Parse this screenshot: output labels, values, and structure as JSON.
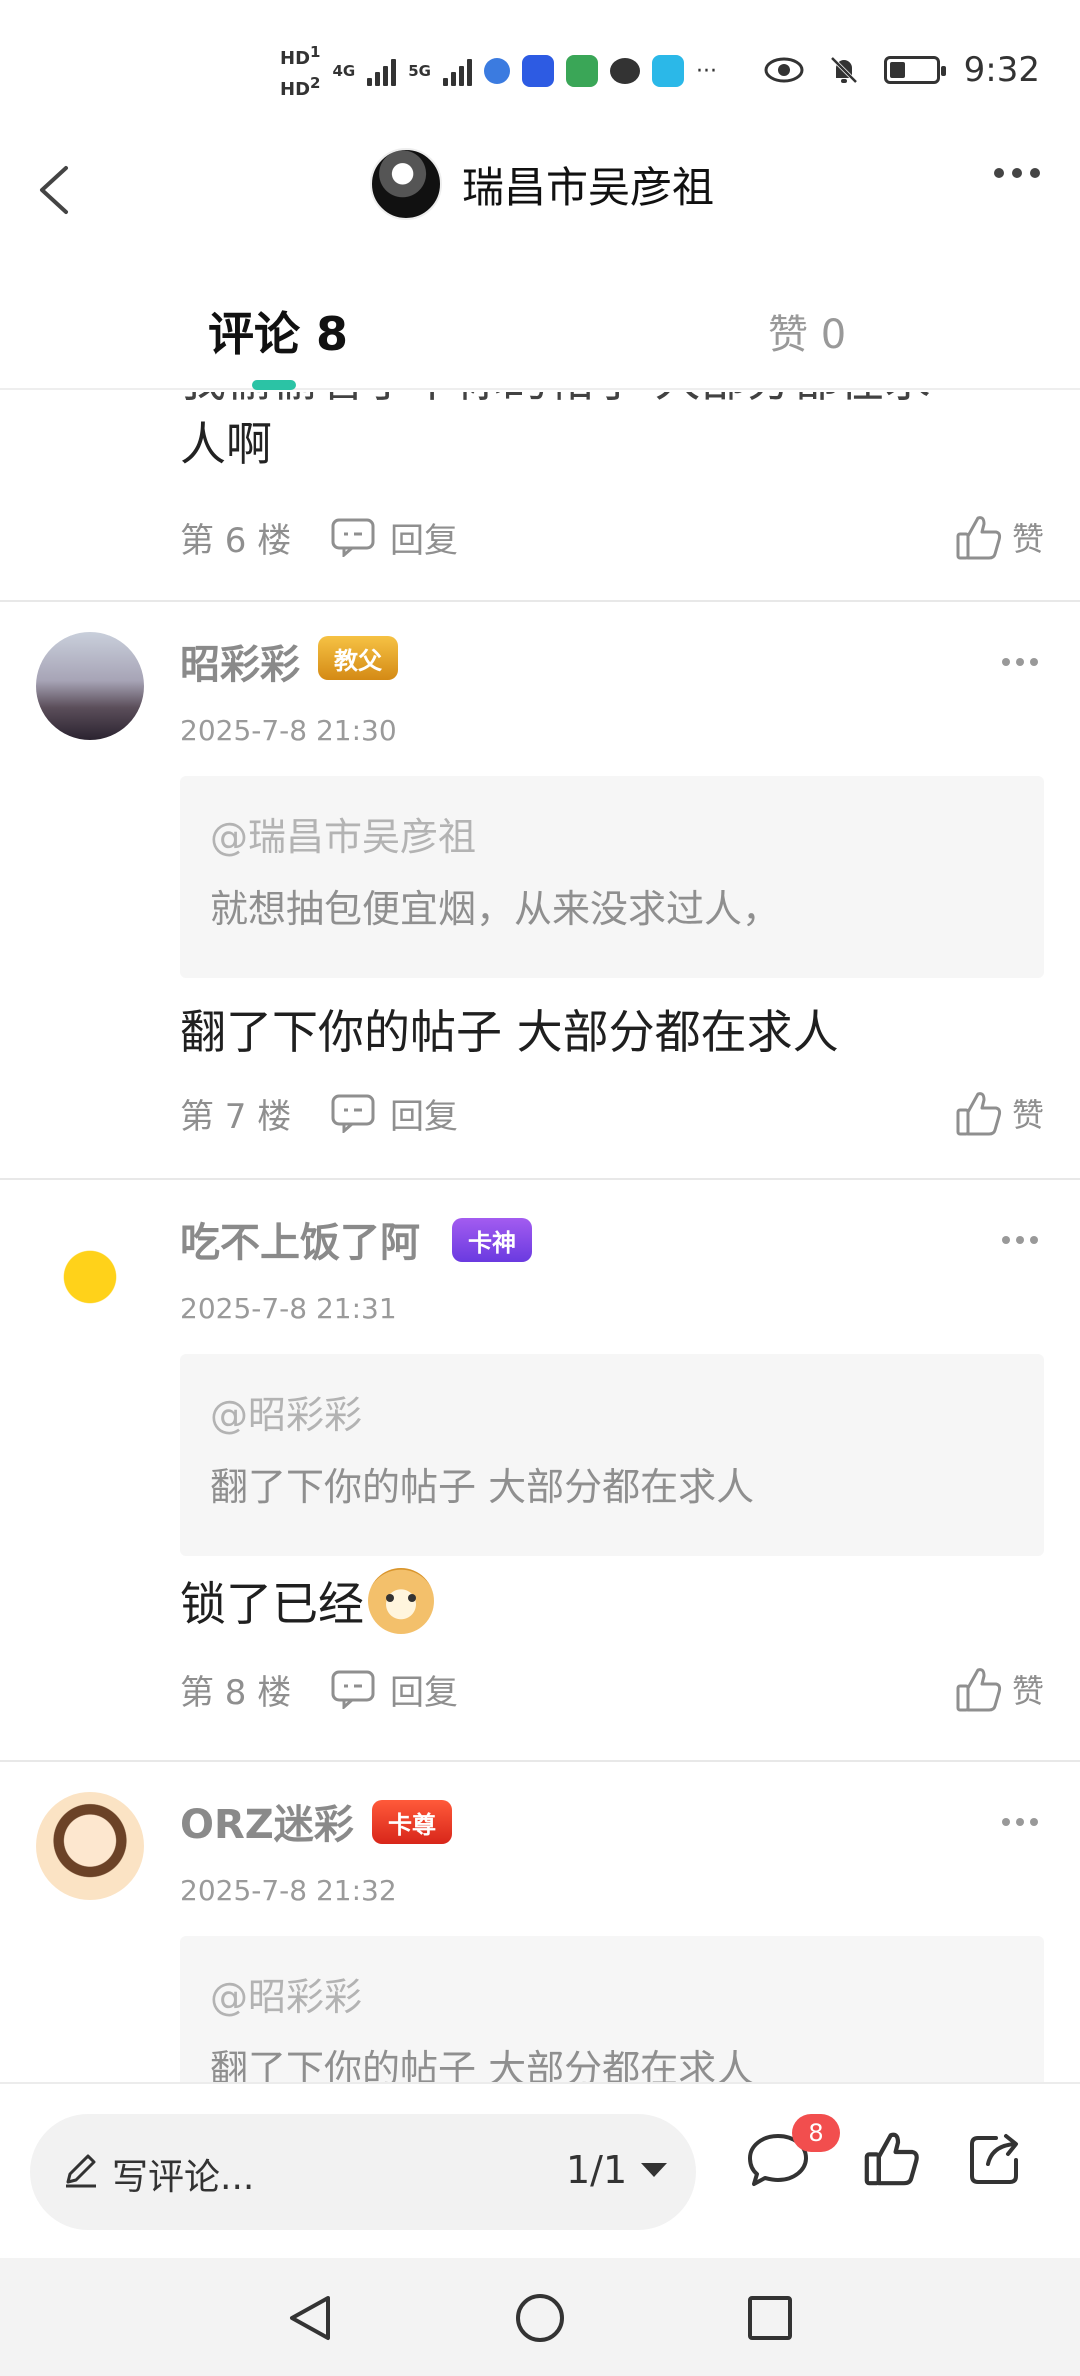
{
  "status_bar": {
    "hd1": "HD",
    "hd1_sub": "1",
    "hd2": "HD",
    "hd2_sub": "2",
    "net1": "4G",
    "net2": "5G",
    "more": "···",
    "time": "9:32",
    "battery_level": 0.35
  },
  "header": {
    "author_name": "瑞昌市吴彦祖"
  },
  "tabs": {
    "comments_label": "评论 8",
    "likes_label": "赞 0"
  },
  "comments": [
    {
      "partial_text_line1": "我偷偷看了下你的帖子 大部分都在求",
      "partial_text_line2": "人啊",
      "floor": "第 6 楼",
      "reply": "回复",
      "like": "赞"
    },
    {
      "username": "昭彩彩",
      "badge": "教父",
      "date": "2025-7-8 21:30",
      "quote_at": "@瑞昌市吴彦祖",
      "quote_text": "就想抽包便宜烟，从来没求过人，",
      "text": "翻了下你的帖子 大部分都在求人",
      "floor": "第 7 楼",
      "reply": "回复",
      "like": "赞"
    },
    {
      "username": "吃不上饭了阿",
      "badge": "卡神",
      "date": "2025-7-8 21:31",
      "quote_at": "@昭彩彩",
      "quote_text": "翻了下你的帖子 大部分都在求人",
      "text": "锁了已经",
      "floor": "第 8 楼",
      "reply": "回复",
      "like": "赞"
    },
    {
      "username": "ORZ迷彩",
      "badge": "卡尊",
      "date": "2025-7-8 21:32",
      "quote_at": "@昭彩彩",
      "quote_text": "翻了下你的帖子 大部分都在求人"
    }
  ],
  "bottom_bar": {
    "input_placeholder": "写评论...",
    "page_indicator": "1/1",
    "comment_count": "8"
  },
  "colors": {
    "accent": "#2bc3a5",
    "badge_red": "#f24e4e",
    "muted": "#8f8f8f"
  }
}
